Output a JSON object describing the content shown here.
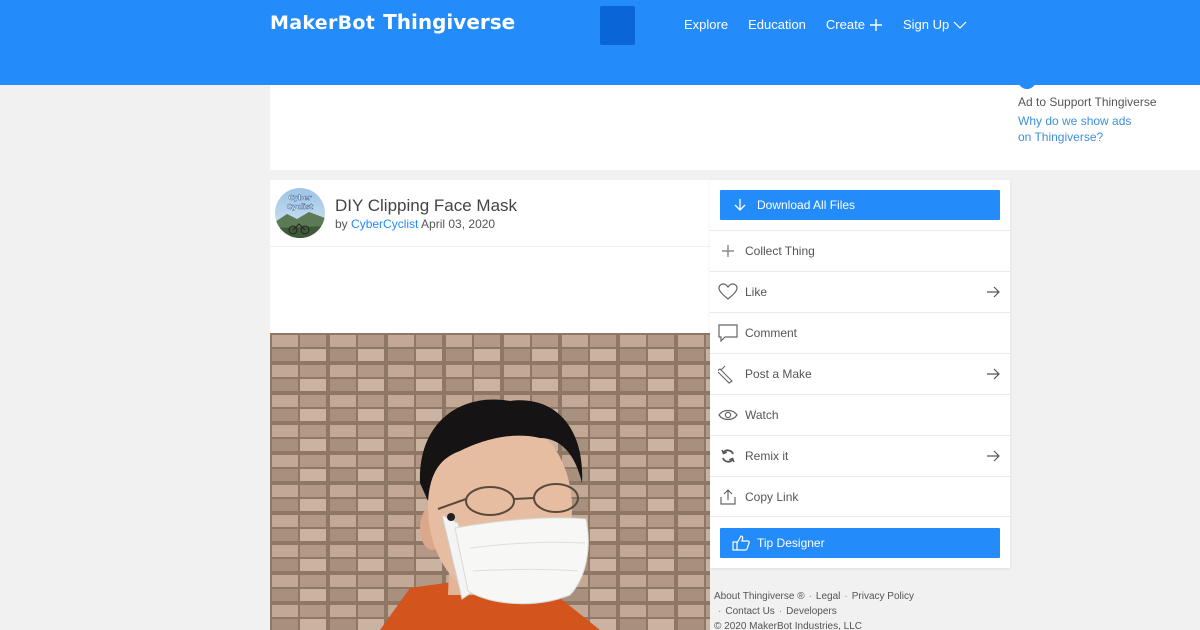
{
  "header": {
    "logo_makerbot": "MakerBot",
    "logo_thingiverse": "Thingiverse",
    "nav": [
      {
        "label": "Explore"
      },
      {
        "label": "Education"
      },
      {
        "label": "Create"
      },
      {
        "label": "Sign Up"
      }
    ]
  },
  "ad": {
    "support_text": "Ad to Support Thingiverse",
    "why_link": "Why do we show ads on Thingiverse?"
  },
  "thing": {
    "title": "DIY Clipping Face Mask",
    "by": "by",
    "author": "CyberCyclist",
    "date": "April 03, 2020",
    "avatar_text": "Cyber Cyclist"
  },
  "actions": {
    "download_label": "Download All Files",
    "items": [
      {
        "label": "Collect Thing",
        "icon": "plus-icon"
      },
      {
        "label": "Like",
        "icon": "heart-icon"
      },
      {
        "label": "Comment",
        "icon": "comment-icon"
      },
      {
        "label": "Post a Make",
        "icon": "pencil-icon"
      },
      {
        "label": "Watch",
        "icon": "eye-icon"
      },
      {
        "label": "Remix it",
        "icon": "remix-icon"
      },
      {
        "label": "Copy Link",
        "icon": "share-icon"
      }
    ],
    "tip_label": "Tip Designer"
  },
  "footer": {
    "about": "About Thingiverse ®",
    "legal": "Legal",
    "privacy": "Privacy Policy",
    "contact": "Contact Us",
    "developers": "Developers",
    "copyright": "© 2020 MakerBot Industries, LLC"
  },
  "colors": {
    "brand_blue": "#248bfb",
    "link_blue": "#3d8edc"
  }
}
